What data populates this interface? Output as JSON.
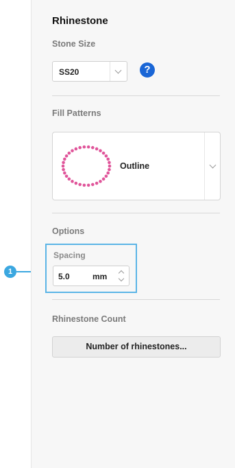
{
  "panel": {
    "title": "Rhinestone",
    "stone_size": {
      "section_label": "Stone Size",
      "selected": "SS20",
      "help_icon": "question-mark-icon",
      "help_glyph": "?"
    },
    "fill_patterns": {
      "section_label": "Fill Patterns",
      "selected_label": "Outline",
      "thumbnail_icon": "outline-dots-pattern-icon",
      "accent_color": "#e0559a"
    },
    "options": {
      "section_label": "Options",
      "spacing_label": "Spacing",
      "spacing_value": "5.0",
      "spacing_unit": "mm"
    },
    "count": {
      "section_label": "Rhinestone Count",
      "button_label": "Number of rhinestones..."
    }
  },
  "callout": {
    "number": "1",
    "color": "#3ba7e0"
  },
  "colors": {
    "help_blue": "#1a66d6",
    "panel_bg": "#f7f7f7"
  }
}
